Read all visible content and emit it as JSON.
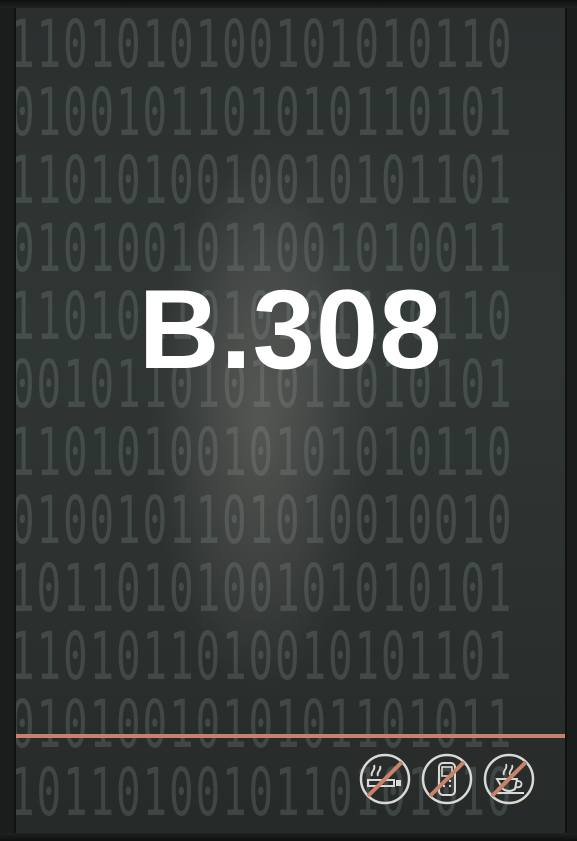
{
  "sign": {
    "room_number": "B.308",
    "accent_color": "#c8826c",
    "text_color": "#ffffff"
  },
  "background_pattern": {
    "rows": [
      "1101010100101010110",
      "0100101101010110101",
      "1101010010010101101",
      "0101001011001010011",
      "1101011010101110110",
      "0010110101011010101",
      "1101010010101010110",
      "0100101101010010010",
      "1011010100101010101",
      "1101011010010101101",
      "0101001010101101011",
      "1011010010110101010"
    ]
  },
  "icons": [
    {
      "name": "no-smoking-icon"
    },
    {
      "name": "no-mobile-phone-icon"
    },
    {
      "name": "no-food-drink-icon"
    }
  ]
}
